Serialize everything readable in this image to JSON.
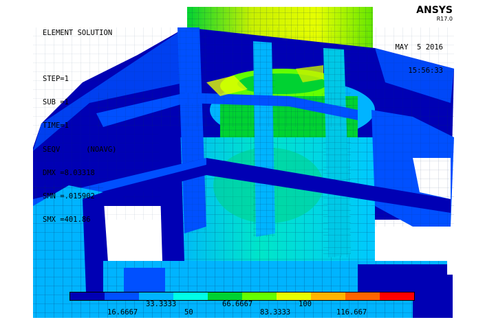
{
  "app": {
    "name": "ANSYS",
    "version": "R17.0"
  },
  "solution": {
    "title": "ELEMENT SOLUTION",
    "lines": [
      "STEP=1",
      "SUB =1",
      "TIME=1",
      "SEQV      (NOAVG)",
      "DMX =8.03318",
      "SMN =.015902",
      "SMX =401.86"
    ]
  },
  "timestamp": {
    "date": "MAY  5 2016",
    "time": "15:56:33"
  },
  "legend": {
    "colors": [
      "#0000b4",
      "#0050ff",
      "#00b4ff",
      "#00ffe6",
      "#00d232",
      "#64ff00",
      "#e6ff00",
      "#ffb400",
      "#ff6400",
      "#ff0000"
    ],
    "upper_labels": [
      "33.3333",
      "66.6667",
      "100"
    ],
    "lower_labels": [
      "16.6667",
      "50",
      "83.3333",
      "116.667"
    ]
  }
}
